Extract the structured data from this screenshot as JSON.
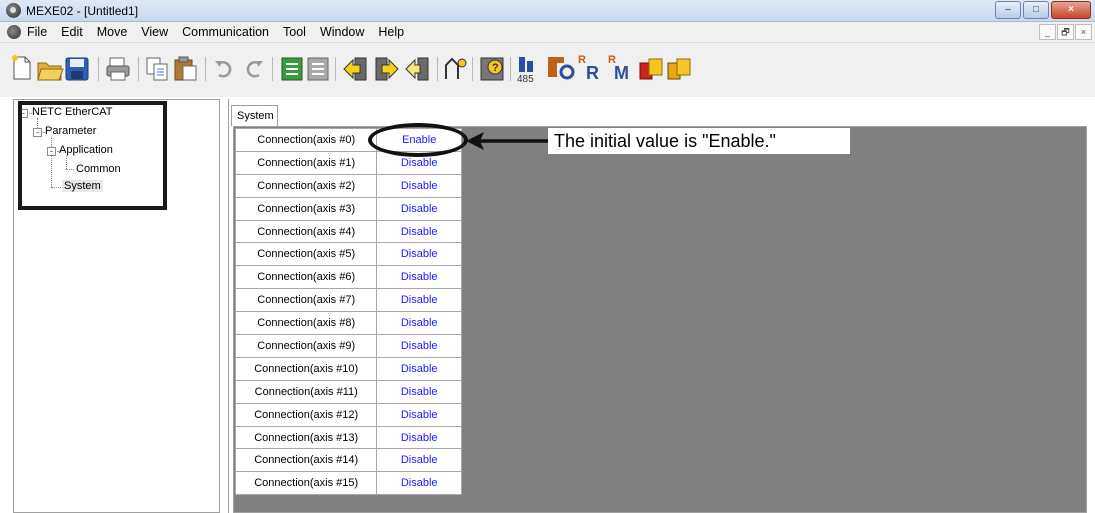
{
  "window": {
    "title": "MEXE02 - [Untitled1]",
    "controls": [
      "–",
      "□",
      "×"
    ]
  },
  "menu": {
    "items": [
      "File",
      "Edit",
      "Move",
      "View",
      "Communication",
      "Tool",
      "Window",
      "Help"
    ],
    "mdi_controls": [
      "_",
      "🗗",
      "×"
    ]
  },
  "toolbar": {
    "icons": [
      "new-file-icon",
      "open-folder-icon",
      "save-icon",
      "print-icon",
      "copy-icon",
      "paste-icon",
      "undo-icon",
      "redo-icon",
      "data-compare-icon",
      "data-reset-icon",
      "read-from-device-icon",
      "write-to-device-icon",
      "verify-icon",
      "teaching-icon",
      "unit-info-icon",
      "rs485-icon",
      "io-monitor-icon",
      "r-io-monitor-icon",
      "m-monitor-icon",
      "alarm-monitor-icon",
      "status-monitor-icon"
    ]
  },
  "tree": {
    "root": "NETC EtherCAT",
    "parameter": "Parameter",
    "application": "Application",
    "common": "Common",
    "system": "System"
  },
  "tabs": {
    "system": "System"
  },
  "grid": {
    "rows": [
      {
        "label": "Connection(axis #0)",
        "value": "Enable"
      },
      {
        "label": "Connection(axis #1)",
        "value": "Disable"
      },
      {
        "label": "Connection(axis #2)",
        "value": "Disable"
      },
      {
        "label": "Connection(axis #3)",
        "value": "Disable"
      },
      {
        "label": "Connection(axis #4)",
        "value": "Disable"
      },
      {
        "label": "Connection(axis #5)",
        "value": "Disable"
      },
      {
        "label": "Connection(axis #6)",
        "value": "Disable"
      },
      {
        "label": "Connection(axis #7)",
        "value": "Disable"
      },
      {
        "label": "Connection(axis #8)",
        "value": "Disable"
      },
      {
        "label": "Connection(axis #9)",
        "value": "Disable"
      },
      {
        "label": "Connection(axis #10)",
        "value": "Disable"
      },
      {
        "label": "Connection(axis #11)",
        "value": "Disable"
      },
      {
        "label": "Connection(axis #12)",
        "value": "Disable"
      },
      {
        "label": "Connection(axis #13)",
        "value": "Disable"
      },
      {
        "label": "Connection(axis #14)",
        "value": "Disable"
      },
      {
        "label": "Connection(axis #15)",
        "value": "Disable"
      }
    ]
  },
  "annotation": {
    "text": "The initial value is \"Enable.\""
  },
  "colors": {
    "value_text": "#1a1aff",
    "panel_gray": "#808080"
  }
}
